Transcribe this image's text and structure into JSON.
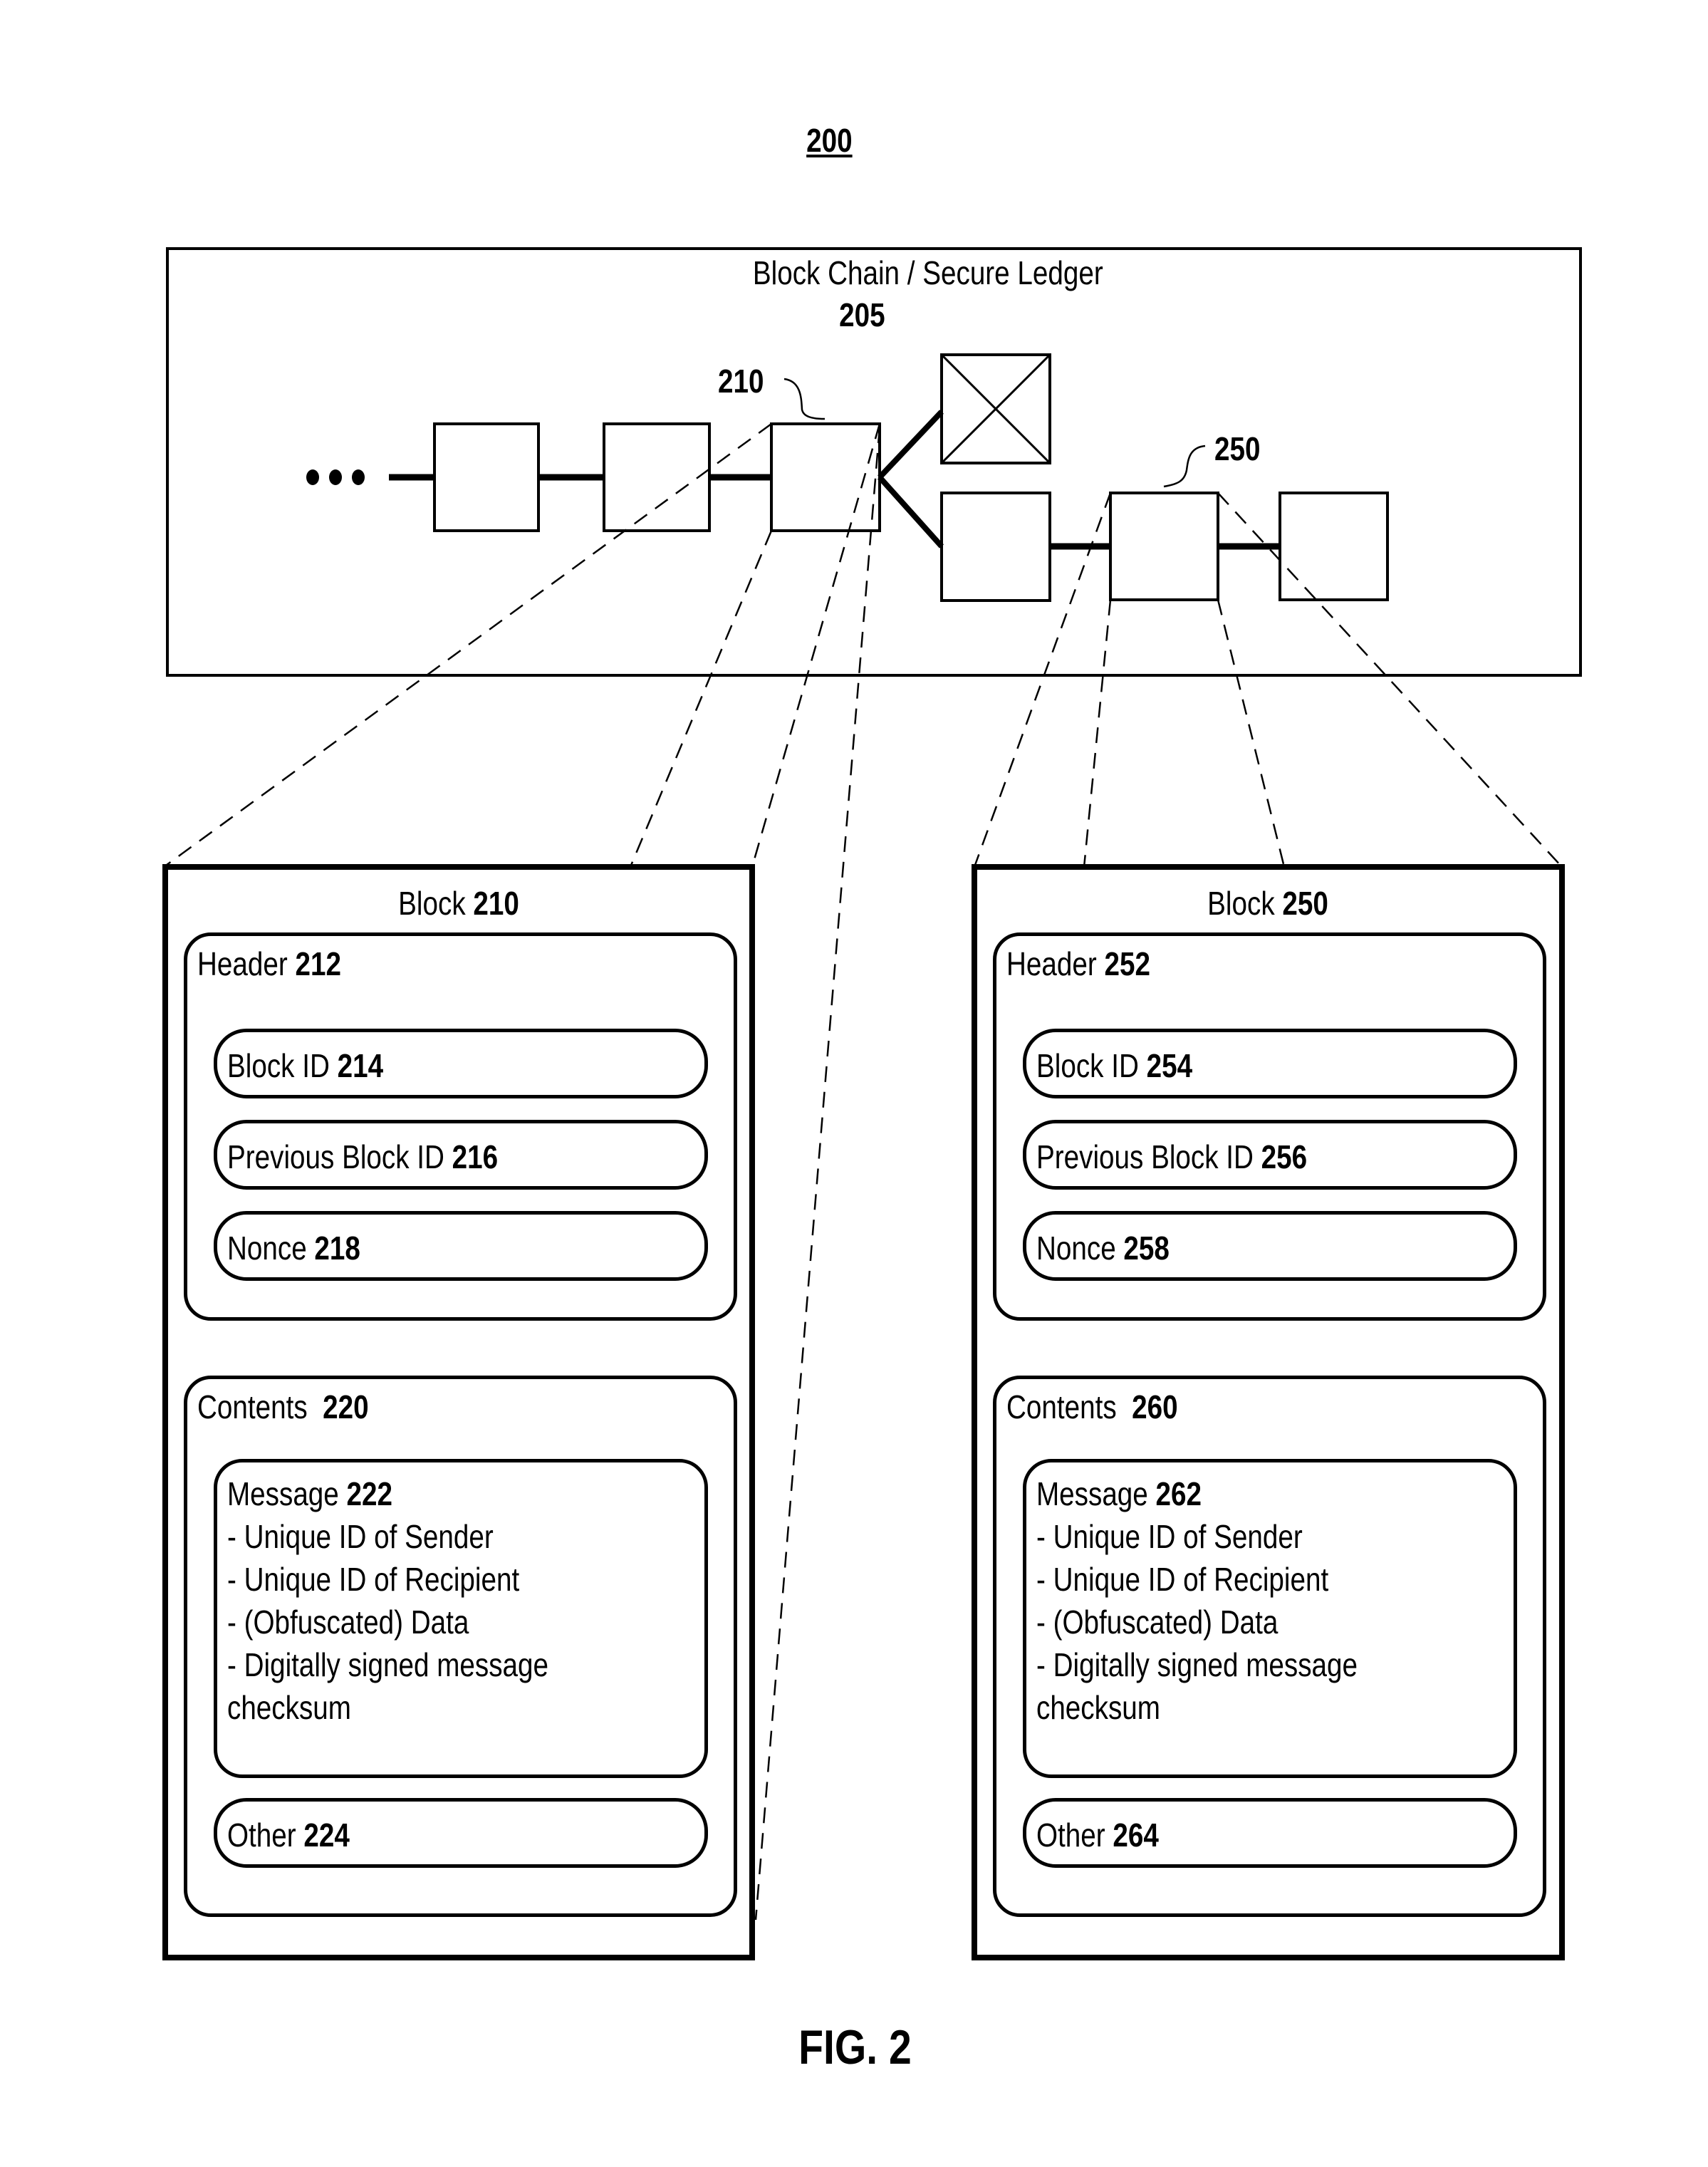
{
  "figure": {
    "number": "200",
    "caption": "FIG. 2"
  },
  "ledger": {
    "title": "Block Chain / Secure Ledger",
    "ref": "205",
    "labels": {
      "block_a": "210",
      "block_b": "250"
    },
    "chain": {
      "ellipsis": "•••",
      "main_blocks": 3,
      "orphaned_block_marked": true,
      "branch_blocks": 3
    }
  },
  "blocks": [
    {
      "title_prefix": "Block",
      "title_ref": "210",
      "header": {
        "label": "Header",
        "ref": "212",
        "fields": [
          {
            "label": "Block ID",
            "ref": "214"
          },
          {
            "label": "Previous Block ID",
            "ref": "216"
          },
          {
            "label": "Nonce",
            "ref": "218"
          }
        ]
      },
      "contents": {
        "label": "Contents",
        "ref": "220",
        "message": {
          "label": "Message",
          "ref": "222",
          "lines": [
            "- Unique ID of Sender",
            "- Unique ID of Recipient",
            "- (Obfuscated) Data",
            "- Digitally signed message",
            "checksum"
          ]
        },
        "other": {
          "label": "Other",
          "ref": "224"
        }
      }
    },
    {
      "title_prefix": "Block",
      "title_ref": "250",
      "header": {
        "label": "Header",
        "ref": "252",
        "fields": [
          {
            "label": "Block ID",
            "ref": "254"
          },
          {
            "label": "Previous Block ID",
            "ref": "256"
          },
          {
            "label": "Nonce",
            "ref": "258"
          }
        ]
      },
      "contents": {
        "label": "Contents",
        "ref": "260",
        "message": {
          "label": "Message",
          "ref": "262",
          "lines": [
            "- Unique ID of Sender",
            "- Unique ID of Recipient",
            "- (Obfuscated) Data",
            "- Digitally signed message",
            "checksum"
          ]
        },
        "other": {
          "label": "Other",
          "ref": "264"
        }
      }
    }
  ]
}
